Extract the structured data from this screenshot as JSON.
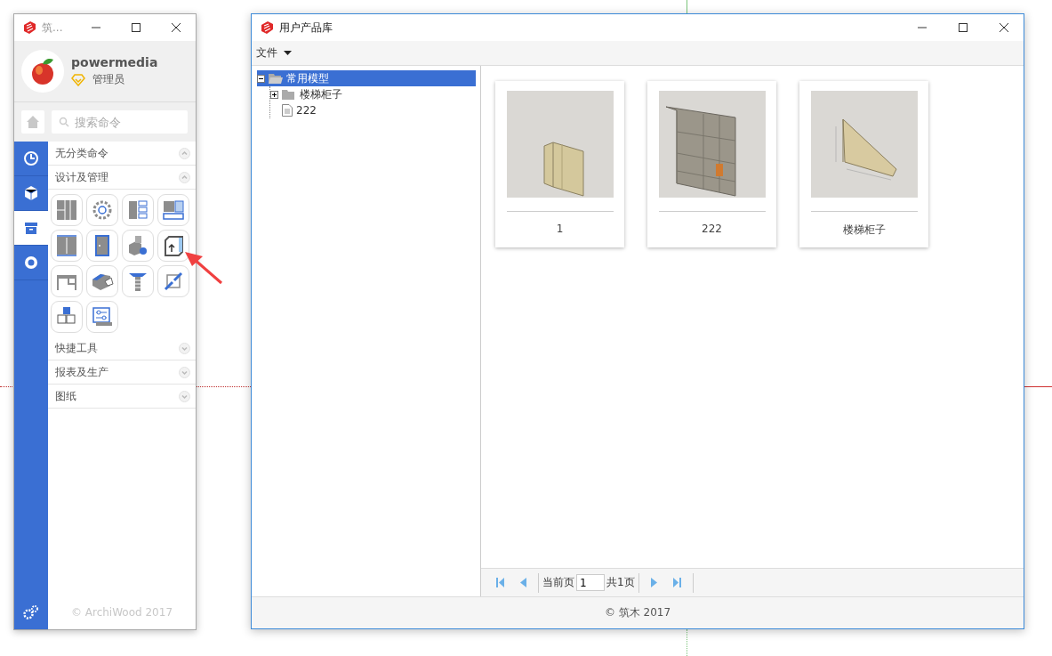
{
  "left_window": {
    "title": "筑...",
    "user": {
      "name": "powermedia",
      "role": "管理员"
    },
    "search": {
      "placeholder": "搜索命令"
    },
    "nav": [
      {
        "kind": "clock",
        "selected": false
      },
      {
        "kind": "cube",
        "selected": false
      },
      {
        "kind": "box",
        "selected": true
      },
      {
        "kind": "ring",
        "selected": false
      }
    ],
    "sections": [
      {
        "label": "无分类命令",
        "expanded": true
      },
      {
        "label": "设计及管理",
        "expanded": true,
        "tools": [
          {
            "kind": "wardrobe"
          },
          {
            "kind": "gear"
          },
          {
            "kind": "shelf"
          },
          {
            "kind": "panel"
          },
          {
            "kind": "doors"
          },
          {
            "kind": "door"
          },
          {
            "kind": "parts"
          },
          {
            "kind": "export"
          },
          {
            "kind": "desk"
          },
          {
            "kind": "board"
          },
          {
            "kind": "screw"
          },
          {
            "kind": "link"
          },
          {
            "kind": "cubes"
          },
          {
            "kind": "sliders"
          }
        ]
      },
      {
        "label": "快捷工具",
        "expanded": false
      },
      {
        "label": "报表及生产",
        "expanded": false
      },
      {
        "label": "图纸",
        "expanded": false
      }
    ],
    "footer": "© ArchiWood 2017"
  },
  "library_window": {
    "title": "用户产品库",
    "menu": [
      {
        "label": "文件"
      }
    ],
    "tree": [
      {
        "label": "常用模型",
        "kind": "folder",
        "selected": true,
        "expanded": true,
        "children": [
          {
            "label": "楼梯柜子",
            "kind": "folder",
            "selected": false,
            "expanded": false
          },
          {
            "label": "222",
            "kind": "file",
            "selected": false
          }
        ]
      }
    ],
    "products": [
      {
        "label": "1",
        "kind": "wardrobe"
      },
      {
        "label": "222",
        "kind": "shelving"
      },
      {
        "label": "楼梯柜子",
        "kind": "stair"
      }
    ],
    "pager": {
      "current_label": "当前页",
      "page": "1",
      "total": "共1页"
    },
    "footer": "© 筑木 2017"
  }
}
